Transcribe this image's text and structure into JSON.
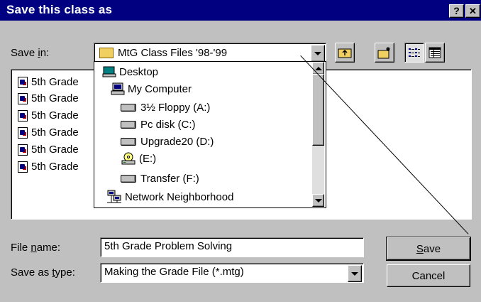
{
  "window": {
    "title": "Save this class as",
    "help_glyph": "?",
    "close_glyph": "✕"
  },
  "save_in": {
    "label_pre": "Save ",
    "label_hot": "i",
    "label_post": "n:",
    "current": "MtG Class Files '98-'99"
  },
  "files": [
    "5th Grade",
    "5th Grade",
    "5th Grade",
    "5th Grade",
    "5th Grade",
    "5th Grade"
  ],
  "dropdown_items": [
    {
      "label": "Desktop",
      "icon": "desktop-icon"
    },
    {
      "label": "My Computer",
      "icon": "computer-icon"
    },
    {
      "label": "3½ Floppy (A:)",
      "icon": "floppy-drive-icon"
    },
    {
      "label": "Pc disk (C:)",
      "icon": "hard-drive-icon"
    },
    {
      "label": "Upgrade20 (D:)",
      "icon": "hard-drive-icon"
    },
    {
      "label": "(E:)",
      "icon": "cd-drive-icon"
    },
    {
      "label": "Transfer (F:)",
      "icon": "hard-drive-icon"
    },
    {
      "label": "Network Neighborhood",
      "icon": "network-icon"
    }
  ],
  "file_name": {
    "label_pre": "File ",
    "label_hot": "n",
    "label_post": "ame:",
    "value": "5th Grade Problem Solving"
  },
  "save_type": {
    "label_pre": "Save as ",
    "label_hot": "t",
    "label_post": "ype:",
    "value": "Making the Grade File (*.mtg)"
  },
  "buttons": {
    "save_hot": "S",
    "save_rest": "ave",
    "cancel": "Cancel"
  },
  "colors": {
    "titlebar": "#000080",
    "face": "#c0c0c0"
  }
}
